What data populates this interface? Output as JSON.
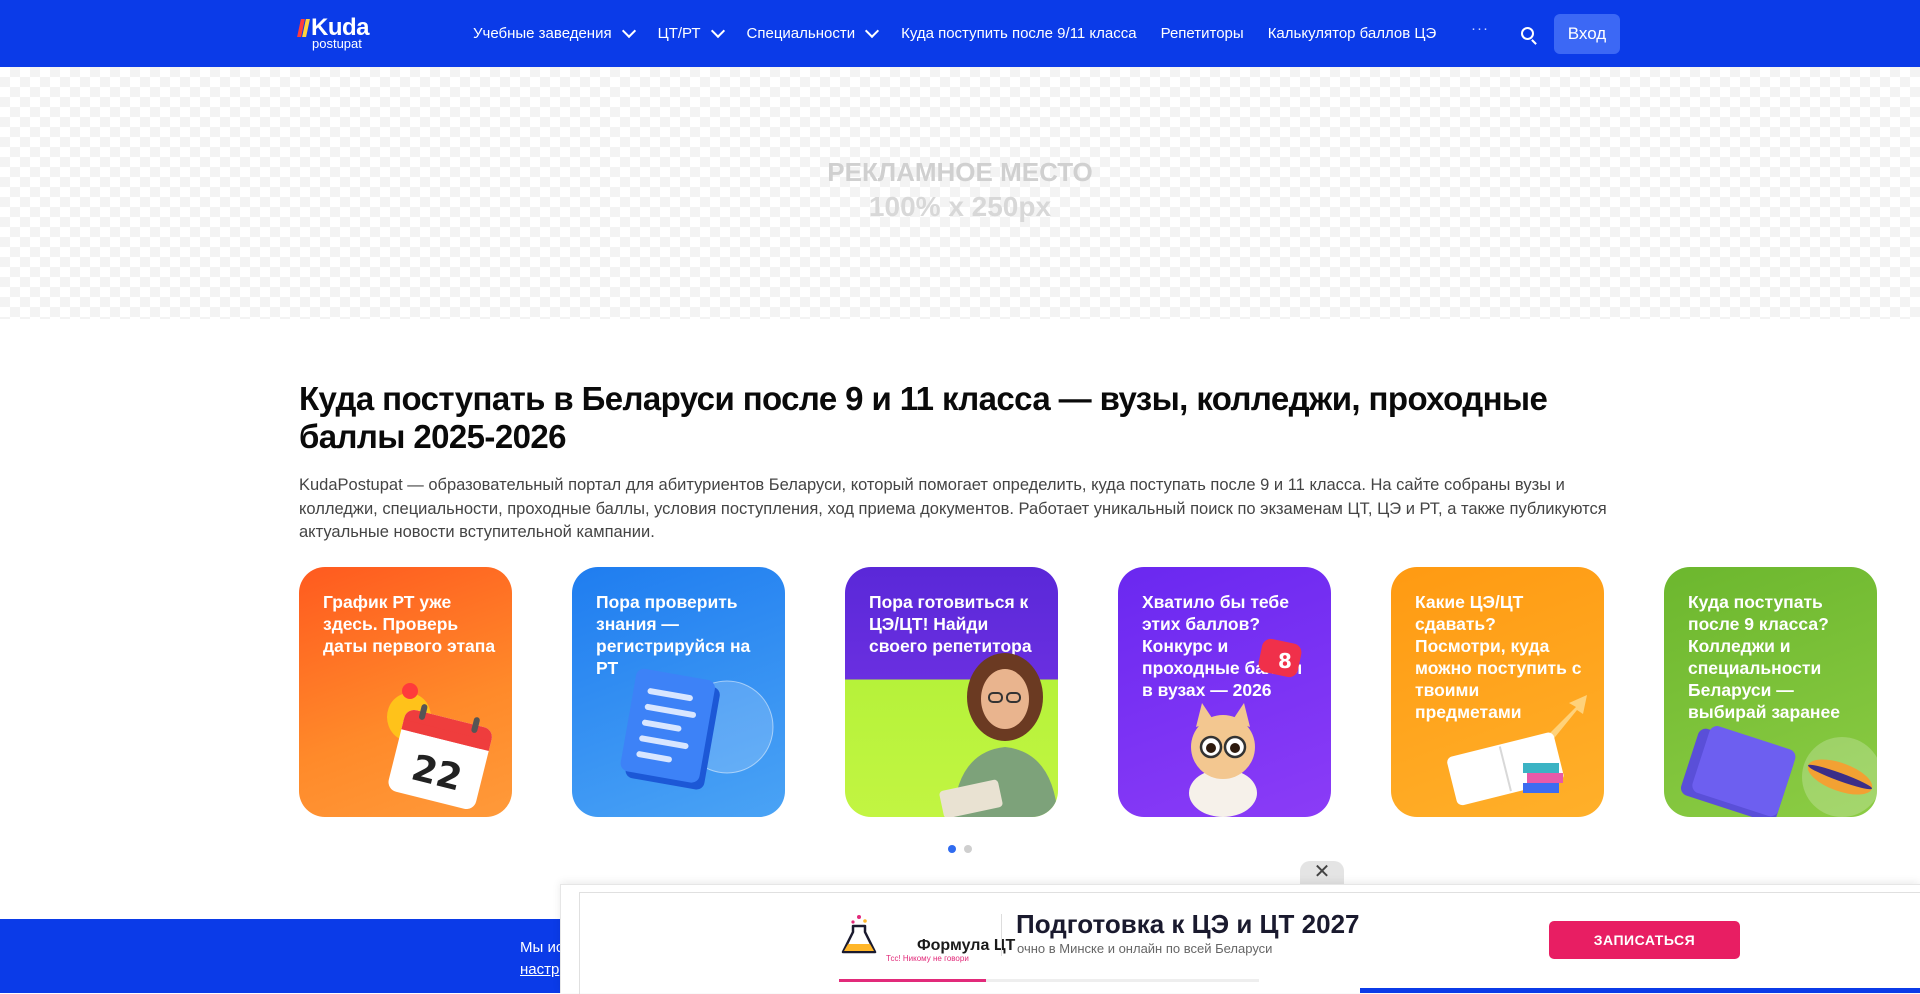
{
  "header": {
    "logo": {
      "word": "Kuda",
      "sub": "postupat"
    },
    "nav": [
      {
        "label": "Учебные заведения",
        "dropdown": true
      },
      {
        "label": "ЦТ/РТ",
        "dropdown": true
      },
      {
        "label": "Специальности",
        "dropdown": true
      },
      {
        "label": "Куда поступить после 9/11 класса",
        "dropdown": false
      },
      {
        "label": "Репетиторы",
        "dropdown": false
      },
      {
        "label": "Калькулятор баллов ЦЭ",
        "dropdown": false
      }
    ],
    "more_label": "···",
    "login_label": "Вход"
  },
  "ad": {
    "line1": "РЕКЛАМНОЕ МЕСТО",
    "line2": "100% x 250px"
  },
  "main": {
    "title": "Куда поступать в Беларуси после 9 и 11 класса — вузы, колледжи, проходные баллы 2025-2026",
    "intro": "KudaPostupat — образовательный портал для абитуриентов Беларуси, который помогает определить, куда поступать после 9 и 11 класса. На сайте собраны вузы и колледжи, специальности, проходные баллы, условия поступления, ход приема документов. Работает уникальный поиск по экзаменам ЦТ, ЦЭ и РТ, а также публикуются актуальные новости вступительной кампании."
  },
  "cards": [
    {
      "text": "График РТ уже здесь. Проверь даты первого этапа",
      "icon": "calendar-icon",
      "color": "#ff6a1a"
    },
    {
      "text": "Пора проверить знания — регистрируйся на РТ",
      "icon": "document-icon",
      "color": "#2f8ff0"
    },
    {
      "text": "Пора готовиться к ЦЭ/ЦТ! Найди своего репетитора",
      "icon": "tutor-photo",
      "color": "#6a2fe0"
    },
    {
      "text": "Хватило бы тебе этих баллов? Конкурс и проходные баллы в вузах — 2026",
      "icon": "cat-icon",
      "badge": "8",
      "color": "#7c2ff5"
    },
    {
      "text": "Какие ЦЭ/ЦТ сдавать? Посмотри, куда можно поступить с твоими предметами",
      "icon": "book-icon",
      "color": "#ffa31a"
    },
    {
      "text": "Куда поступать после 9 класса? Колледжи и специальности Беларуси — выбирай заранее",
      "icon": "folder-icon",
      "color": "#7fc23a"
    }
  ],
  "carousel": {
    "pages": 2,
    "active": 0
  },
  "cookie": {
    "line1": "Мы ис",
    "line2": "настр"
  },
  "promo": {
    "brand": "Формула ЦТ",
    "brand_tagline": "Тсс! Никому не говори",
    "title": "Подготовка к ЦЭ и ЦТ 2027",
    "subtitle": "очно в Минске и онлайн по всей Беларуси",
    "cta": "ЗАПИСАТЬСЯ",
    "close_label": "✕",
    "progress": 0.35
  }
}
